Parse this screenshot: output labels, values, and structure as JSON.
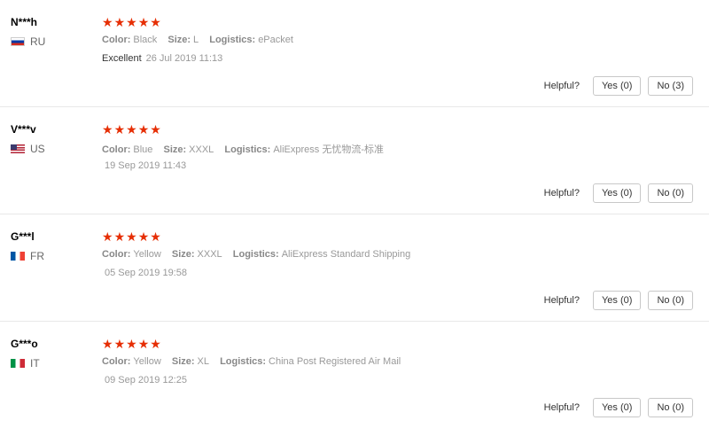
{
  "labels": {
    "color": "Color:",
    "size": "Size:",
    "logistics": "Logistics:",
    "helpful": "Helpful?"
  },
  "colors": {
    "star": "#e62e04",
    "border": "#e8e8e8"
  },
  "reviews": [
    {
      "user": "N***h",
      "country": "RU",
      "flag_icon": "flag-ru",
      "stars": 5,
      "color": "Black",
      "size": "L",
      "logistics": "ePacket",
      "text": "Excellent",
      "date": "26 Jul 2019 11:13",
      "yes": "Yes (0)",
      "no": "No (3)"
    },
    {
      "user": "V***v",
      "country": "US",
      "flag_icon": "flag-us",
      "stars": 5,
      "color": "Blue",
      "size": "XXXL",
      "logistics": "AliExpress 无忧物流-标准",
      "text": "",
      "date": "19 Sep 2019 11:43",
      "yes": "Yes (0)",
      "no": "No (0)"
    },
    {
      "user": "G***l",
      "country": "FR",
      "flag_icon": "flag-fr",
      "stars": 5,
      "color": "Yellow",
      "size": "XXXL",
      "logistics": "AliExpress Standard Shipping",
      "text": "",
      "date": "05 Sep 2019 19:58",
      "yes": "Yes (0)",
      "no": "No (0)"
    },
    {
      "user": "G***o",
      "country": "IT",
      "flag_icon": "flag-it",
      "stars": 5,
      "color": "Yellow",
      "size": "XL",
      "logistics": "China Post Registered Air Mail",
      "text": "",
      "date": "09 Sep 2019 12:25",
      "yes": "Yes (0)",
      "no": "No (0)"
    }
  ]
}
